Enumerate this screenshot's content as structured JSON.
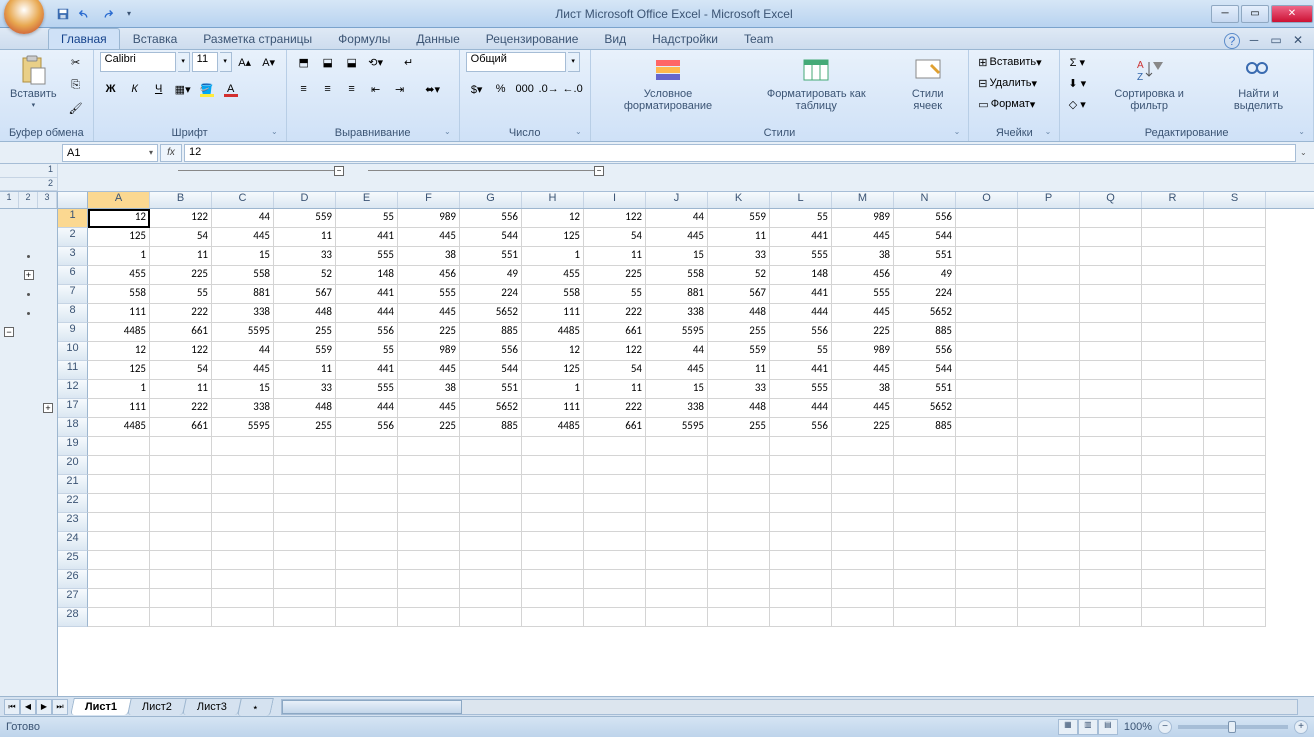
{
  "title": "Лист Microsoft Office Excel - Microsoft Excel",
  "tabs": [
    "Главная",
    "Вставка",
    "Разметка страницы",
    "Формулы",
    "Данные",
    "Рецензирование",
    "Вид",
    "Надстройки",
    "Team"
  ],
  "activeTab": 0,
  "ribbon": {
    "clipboard": {
      "paste": "Вставить",
      "label": "Буфер обмена"
    },
    "font": {
      "name": "Calibri",
      "size": "11",
      "label": "Шрифт",
      "bold": "Ж",
      "italic": "К",
      "underline": "Ч"
    },
    "align": {
      "label": "Выравнивание"
    },
    "number": {
      "format": "Общий",
      "label": "Число"
    },
    "styles": {
      "cond": "Условное\nформатирование",
      "table": "Форматировать\nкак таблицу",
      "cell": "Стили\nячеек",
      "label": "Стили"
    },
    "cells": {
      "insert": "Вставить",
      "delete": "Удалить",
      "format": "Формат",
      "label": "Ячейки"
    },
    "editing": {
      "sort": "Сортировка\nи фильтр",
      "find": "Найти и\nвыделить",
      "label": "Редактирование"
    }
  },
  "nameBox": "A1",
  "formula": "12",
  "columns": [
    "A",
    "B",
    "C",
    "D",
    "E",
    "F",
    "G",
    "H",
    "I",
    "J",
    "K",
    "L",
    "M",
    "N",
    "O",
    "P",
    "Q",
    "R",
    "S"
  ],
  "rowNumbers": [
    1,
    2,
    3,
    6,
    7,
    8,
    9,
    10,
    11,
    12,
    17,
    18,
    19,
    20,
    21,
    22,
    23,
    24,
    25,
    26,
    27,
    28
  ],
  "rowOutline": [
    "",
    "",
    "dot",
    "plus",
    "dot",
    "dot",
    "minus3",
    "",
    "",
    "",
    "plus3",
    "",
    "",
    "",
    "",
    "",
    "",
    "",
    "",
    "",
    "",
    ""
  ],
  "data": {
    "1": [
      12,
      122,
      44,
      559,
      55,
      989,
      556,
      12,
      122,
      44,
      559,
      55,
      989,
      556
    ],
    "2": [
      125,
      54,
      445,
      11,
      441,
      445,
      544,
      125,
      54,
      445,
      11,
      441,
      445,
      544
    ],
    "3": [
      1,
      11,
      15,
      33,
      555,
      38,
      551,
      1,
      11,
      15,
      33,
      555,
      38,
      551
    ],
    "6": [
      455,
      225,
      558,
      52,
      148,
      456,
      49,
      455,
      225,
      558,
      52,
      148,
      456,
      49
    ],
    "7": [
      558,
      55,
      881,
      567,
      441,
      555,
      224,
      558,
      55,
      881,
      567,
      441,
      555,
      224
    ],
    "8": [
      111,
      222,
      338,
      448,
      444,
      445,
      5652,
      111,
      222,
      338,
      448,
      444,
      445,
      5652
    ],
    "9": [
      4485,
      661,
      5595,
      255,
      556,
      225,
      885,
      4485,
      661,
      5595,
      255,
      556,
      225,
      885
    ],
    "10": [
      12,
      122,
      44,
      559,
      55,
      989,
      556,
      12,
      122,
      44,
      559,
      55,
      989,
      556
    ],
    "11": [
      125,
      54,
      445,
      11,
      441,
      445,
      544,
      125,
      54,
      445,
      11,
      441,
      445,
      544
    ],
    "12": [
      1,
      11,
      15,
      33,
      555,
      38,
      551,
      1,
      11,
      15,
      33,
      555,
      38,
      551
    ],
    "17": [
      111,
      222,
      338,
      448,
      444,
      445,
      5652,
      111,
      222,
      338,
      448,
      444,
      445,
      5652
    ],
    "18": [
      4485,
      661,
      5595,
      255,
      556,
      225,
      885,
      4485,
      661,
      5595,
      255,
      556,
      225,
      885
    ]
  },
  "sheets": [
    "Лист1",
    "Лист2",
    "Лист3"
  ],
  "activeSheet": 0,
  "status": "Готово",
  "zoom": "100%"
}
